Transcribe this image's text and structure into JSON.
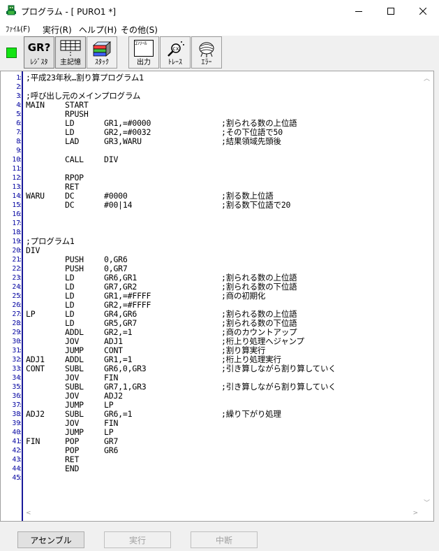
{
  "window": {
    "title": "プログラム - [ PURO1 *]",
    "icon": "app-robot-icon",
    "controls": [
      "minimize-icon",
      "maximize-icon",
      "close-icon"
    ]
  },
  "menu": [
    {
      "label": "ﾌｧｲﾙ(F)"
    },
    {
      "label": "実行(R)"
    },
    {
      "label": "ヘルプ(H)"
    },
    {
      "label": "その他(S)"
    }
  ],
  "toolbar": {
    "status_color": "#13e413",
    "buttons": [
      {
        "label": "ﾚｼﾞｽﾀ",
        "icon_text": "GR?",
        "icon": "register-icon",
        "pressed": true
      },
      {
        "label": "主記憶",
        "icon": "memory-grid-icon",
        "pressed": true
      },
      {
        "label": "ｽﾀｯｸ",
        "icon": "stack-icon",
        "pressed": false
      },
      {
        "label": "出力",
        "icon_text": "ｺﾝｿｰﾙ",
        "icon": "console-icon",
        "pressed": false
      },
      {
        "label": "ﾄﾚｰｽ",
        "icon": "trace-magnifier-icon",
        "pressed": false
      },
      {
        "label": "ｴﾗｰ",
        "icon": "error-bug-icon",
        "pressed": false
      }
    ]
  },
  "editor": {
    "lines": [
      {
        "n": "1",
        "label": ";平成23年秋…割り算プログラム1",
        "op": "",
        "arg": "",
        "comment": ""
      },
      {
        "n": "2",
        "label": "",
        "op": "",
        "arg": "",
        "comment": ""
      },
      {
        "n": "3",
        "label": ";呼び出し元のメインプログラム",
        "op": "",
        "arg": "",
        "comment": ""
      },
      {
        "n": "4",
        "label": "MAIN",
        "op": "START",
        "arg": "",
        "comment": ""
      },
      {
        "n": "5",
        "label": "",
        "op": "RPUSH",
        "arg": "",
        "comment": ""
      },
      {
        "n": "6",
        "label": "",
        "op": "LD",
        "arg": "GR1,=#0000",
        "comment": ";割られる数の上位語"
      },
      {
        "n": "7",
        "label": "",
        "op": "LD",
        "arg": "GR2,=#0032",
        "comment": ";その下位語で50"
      },
      {
        "n": "8",
        "label": "",
        "op": "LAD",
        "arg": "GR3,WARU",
        "comment": ";結果領域先頭後"
      },
      {
        "n": "9",
        "label": "",
        "op": "",
        "arg": "",
        "comment": ""
      },
      {
        "n": "10",
        "label": "",
        "op": "CALL",
        "arg": "DIV",
        "comment": ""
      },
      {
        "n": "11",
        "label": "",
        "op": "",
        "arg": "",
        "comment": ""
      },
      {
        "n": "12",
        "label": "",
        "op": "RPOP",
        "arg": "",
        "comment": ""
      },
      {
        "n": "13",
        "label": "",
        "op": "RET",
        "arg": "",
        "comment": ""
      },
      {
        "n": "14",
        "label": "WARU",
        "op": "DC",
        "arg": "#0000",
        "comment": ";割る数上位語"
      },
      {
        "n": "15",
        "label": "",
        "op": "DC",
        "arg": "#00|14",
        "comment": ";割る数下位語で20"
      },
      {
        "n": "16",
        "label": "",
        "op": "",
        "arg": "",
        "comment": ""
      },
      {
        "n": "17",
        "label": "",
        "op": "",
        "arg": "",
        "comment": ""
      },
      {
        "n": "18",
        "label": "",
        "op": "",
        "arg": "",
        "comment": ""
      },
      {
        "n": "19",
        "label": ";プログラム1",
        "op": "",
        "arg": "",
        "comment": ""
      },
      {
        "n": "20",
        "label": "DIV",
        "op": "",
        "arg": "",
        "comment": ""
      },
      {
        "n": "21",
        "label": "",
        "op": "PUSH",
        "arg": "0,GR6",
        "comment": ""
      },
      {
        "n": "22",
        "label": "",
        "op": "PUSH",
        "arg": "0,GR7",
        "comment": ""
      },
      {
        "n": "23",
        "label": "",
        "op": "LD",
        "arg": "GR6,GR1",
        "comment": ";割られる数の上位語"
      },
      {
        "n": "24",
        "label": "",
        "op": "LD",
        "arg": "GR7,GR2",
        "comment": ";割られる数の下位語"
      },
      {
        "n": "25",
        "label": "",
        "op": "LD",
        "arg": "GR1,=#FFFF",
        "comment": ";商の初期化"
      },
      {
        "n": "26",
        "label": "",
        "op": "LD",
        "arg": "GR2,=#FFFF",
        "comment": ""
      },
      {
        "n": "27",
        "label": "LP",
        "op": "LD",
        "arg": "GR4,GR6",
        "comment": ";割られる数の上位語"
      },
      {
        "n": "28",
        "label": "",
        "op": "LD",
        "arg": "GR5,GR7",
        "comment": ";割られる数の下位語"
      },
      {
        "n": "29",
        "label": "",
        "op": "ADDL",
        "arg": "GR2,=1",
        "comment": ";商のカウントアップ"
      },
      {
        "n": "30",
        "label": "",
        "op": "JOV",
        "arg": "ADJ1",
        "comment": ";桁上り処理へジャンプ"
      },
      {
        "n": "31",
        "label": "",
        "op": "JUMP",
        "arg": "CONT",
        "comment": ";割り算実行"
      },
      {
        "n": "32",
        "label": "ADJ1",
        "op": "ADDL",
        "arg": "GR1,=1",
        "comment": ";桁上り処理実行"
      },
      {
        "n": "33",
        "label": "CONT",
        "op": "SUBL",
        "arg": "GR6,0,GR3",
        "comment": ";引き算しながら割り算していく"
      },
      {
        "n": "34",
        "label": "",
        "op": "JOV",
        "arg": "FIN",
        "comment": ""
      },
      {
        "n": "35",
        "label": "",
        "op": "SUBL",
        "arg": "GR7,1,GR3",
        "comment": ";引き算しながら割り算していく"
      },
      {
        "n": "36",
        "label": "",
        "op": "JOV",
        "arg": "ADJ2",
        "comment": ""
      },
      {
        "n": "37",
        "label": "",
        "op": "JUMP",
        "arg": "LP",
        "comment": ""
      },
      {
        "n": "38",
        "label": "ADJ2",
        "op": "SUBL",
        "arg": "GR6,=1",
        "comment": ";繰り下がり処理"
      },
      {
        "n": "39",
        "label": "",
        "op": "JOV",
        "arg": "FIN",
        "comment": ""
      },
      {
        "n": "40",
        "label": "",
        "op": "JUMP",
        "arg": "LP",
        "comment": ""
      },
      {
        "n": "41",
        "label": "FIN",
        "op": "POP",
        "arg": "GR7",
        "comment": ""
      },
      {
        "n": "42",
        "label": "",
        "op": "POP",
        "arg": "GR6",
        "comment": ""
      },
      {
        "n": "43",
        "label": "",
        "op": "RET",
        "arg": "",
        "comment": ""
      },
      {
        "n": "44",
        "label": "",
        "op": "END",
        "arg": "",
        "comment": ""
      },
      {
        "n": "45",
        "label": "",
        "op": "",
        "arg": "",
        "comment": ""
      }
    ]
  },
  "bottom": {
    "assemble": "アセンブル",
    "run": "実行",
    "stop": "中断"
  }
}
